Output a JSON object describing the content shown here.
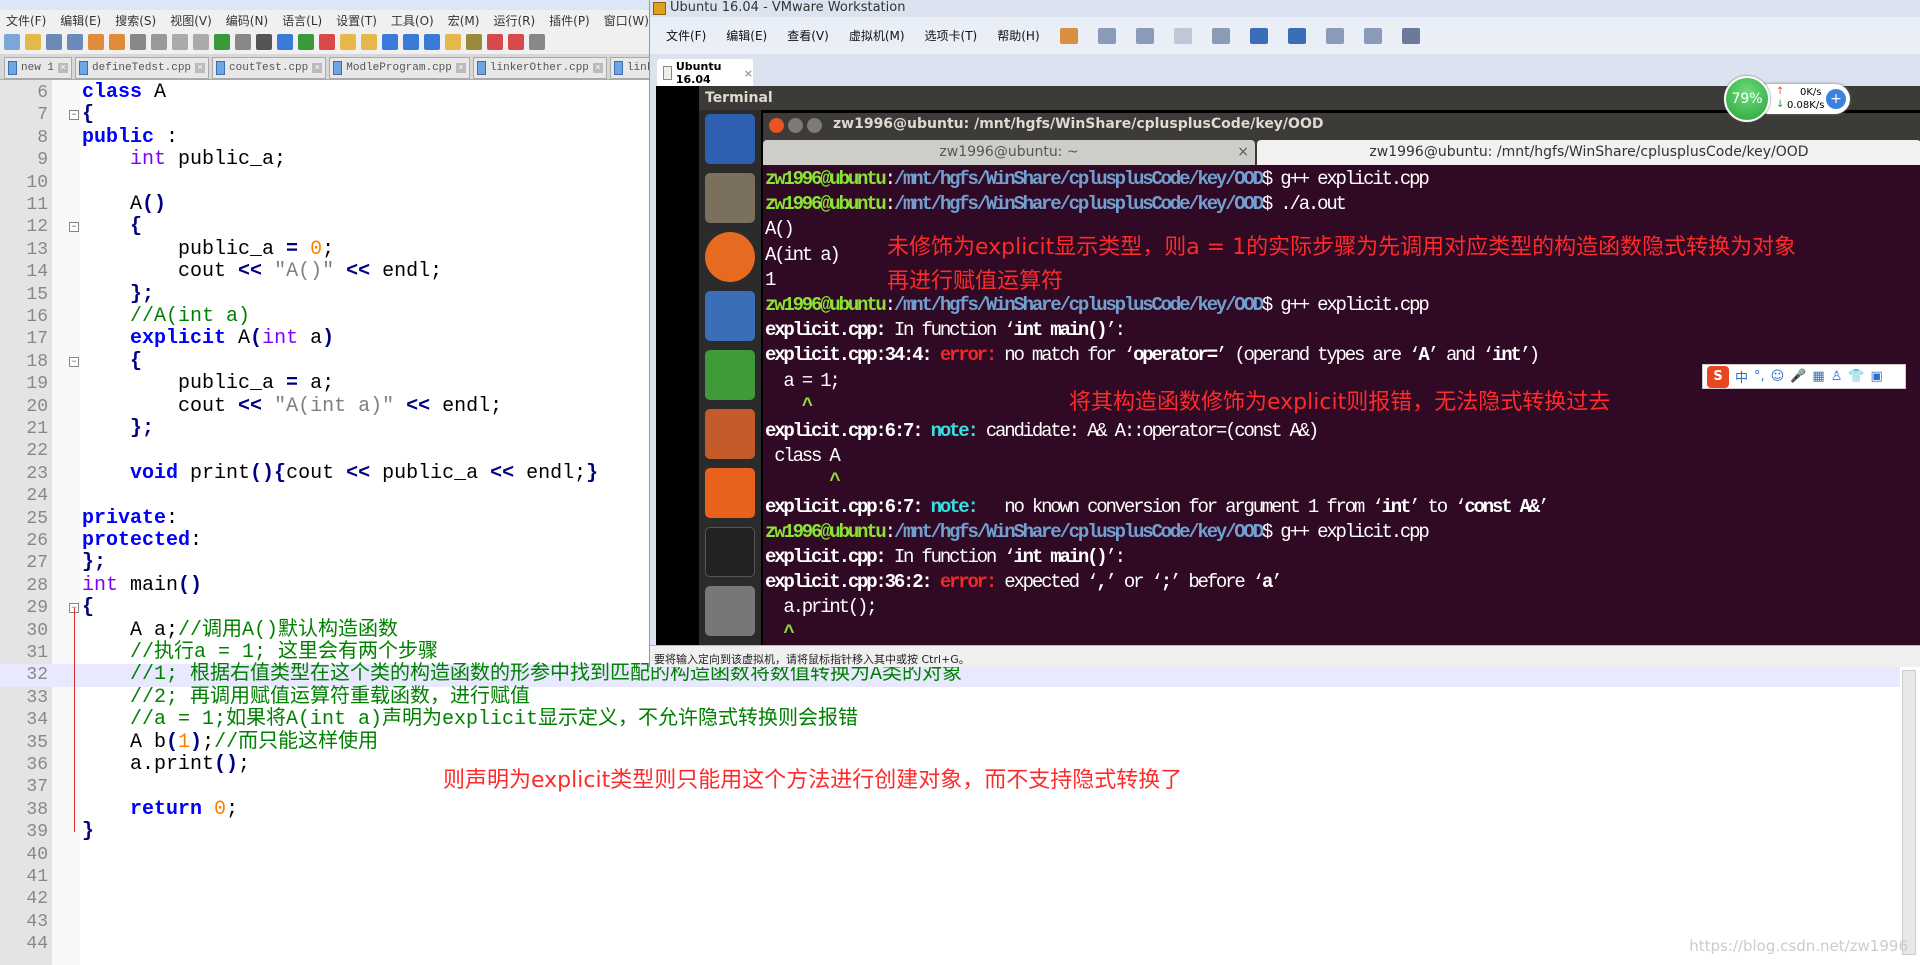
{
  "notepad": {
    "menu": [
      "文件(F)",
      "编辑(E)",
      "搜索(S)",
      "视图(V)",
      "编码(N)",
      "语言(L)",
      "设置(T)",
      "工具(O)",
      "宏(M)",
      "运行(R)",
      "插件(P)",
      "窗口(W)"
    ],
    "tabs": [
      "new 1",
      "defineTedst.cpp",
      "coutTest.cpp",
      "ModleProgram.cpp",
      "linkerOther.cpp",
      "linker."
    ],
    "highlight_line": 32,
    "code": [
      {
        "n": 6,
        "t": [
          [
            "class",
            "kw"
          ],
          [
            " A",
            "pl"
          ]
        ]
      },
      {
        "n": 7,
        "t": [
          [
            "{",
            "op"
          ]
        ],
        "fold": "-"
      },
      {
        "n": 8,
        "t": [
          [
            "public",
            "kw"
          ],
          [
            " :",
            "pl"
          ]
        ]
      },
      {
        "n": 9,
        "t": [
          [
            "    ",
            "pl"
          ],
          [
            "int",
            "type"
          ],
          [
            " public_a;",
            "pl"
          ]
        ]
      },
      {
        "n": 10,
        "t": []
      },
      {
        "n": 11,
        "t": [
          [
            "    A",
            "pl"
          ],
          [
            "()",
            "op"
          ]
        ]
      },
      {
        "n": 12,
        "t": [
          [
            "    ",
            "pl"
          ],
          [
            "{",
            "op"
          ]
        ],
        "fold": "-"
      },
      {
        "n": 13,
        "t": [
          [
            "        public_a ",
            "pl"
          ],
          [
            "=",
            "op"
          ],
          [
            " ",
            "pl"
          ],
          [
            "0",
            "num"
          ],
          [
            ";",
            "pl"
          ]
        ]
      },
      {
        "n": 14,
        "t": [
          [
            "        cout ",
            "pl"
          ],
          [
            "<<",
            "op"
          ],
          [
            " ",
            "pl"
          ],
          [
            "\"A()\"",
            "str"
          ],
          [
            " ",
            "pl"
          ],
          [
            "<<",
            "op"
          ],
          [
            " endl;",
            "pl"
          ]
        ]
      },
      {
        "n": 15,
        "t": [
          [
            "    ",
            "pl"
          ],
          [
            "};",
            "op"
          ]
        ]
      },
      {
        "n": 16,
        "t": [
          [
            "    ",
            "pl"
          ],
          [
            "//A(int a)",
            "cm"
          ]
        ]
      },
      {
        "n": 17,
        "t": [
          [
            "    ",
            "pl"
          ],
          [
            "explicit",
            "kw"
          ],
          [
            " A",
            "pl"
          ],
          [
            "(",
            "op"
          ],
          [
            "int",
            "type"
          ],
          [
            " a",
            "pl"
          ],
          [
            ")",
            "op"
          ]
        ]
      },
      {
        "n": 18,
        "t": [
          [
            "    ",
            "pl"
          ],
          [
            "{",
            "op"
          ]
        ],
        "fold": "-"
      },
      {
        "n": 19,
        "t": [
          [
            "        public_a ",
            "pl"
          ],
          [
            "=",
            "op"
          ],
          [
            " a;",
            "pl"
          ]
        ]
      },
      {
        "n": 20,
        "t": [
          [
            "        cout ",
            "pl"
          ],
          [
            "<<",
            "op"
          ],
          [
            " ",
            "pl"
          ],
          [
            "\"A(int a)\"",
            "str"
          ],
          [
            " ",
            "pl"
          ],
          [
            "<<",
            "op"
          ],
          [
            " endl;",
            "pl"
          ]
        ]
      },
      {
        "n": 21,
        "t": [
          [
            "    ",
            "pl"
          ],
          [
            "};",
            "op"
          ]
        ]
      },
      {
        "n": 22,
        "t": []
      },
      {
        "n": 23,
        "t": [
          [
            "    ",
            "pl"
          ],
          [
            "void",
            "kw"
          ],
          [
            " print",
            "pl"
          ],
          [
            "(){",
            "op"
          ],
          [
            "cout ",
            "pl"
          ],
          [
            "<<",
            "op"
          ],
          [
            " public_a ",
            "pl"
          ],
          [
            "<<",
            "op"
          ],
          [
            " endl;",
            "pl"
          ],
          [
            "}",
            "op"
          ]
        ]
      },
      {
        "n": 24,
        "t": []
      },
      {
        "n": 25,
        "t": [
          [
            "private",
            "kw"
          ],
          [
            ":",
            "pl"
          ]
        ]
      },
      {
        "n": 26,
        "t": [
          [
            "protected",
            "kw"
          ],
          [
            ":",
            "pl"
          ]
        ]
      },
      {
        "n": 27,
        "t": [
          [
            "};",
            "op"
          ]
        ]
      },
      {
        "n": 28,
        "t": [
          [
            "int",
            "type"
          ],
          [
            " main",
            "pl"
          ],
          [
            "()",
            "op"
          ]
        ]
      },
      {
        "n": 29,
        "t": [
          [
            "{",
            "op"
          ]
        ],
        "fold": "-"
      },
      {
        "n": 30,
        "t": [
          [
            "    A a;",
            "pl"
          ],
          [
            "//调用A()默认构造函数",
            "cm"
          ]
        ]
      },
      {
        "n": 31,
        "t": [
          [
            "    ",
            "pl"
          ],
          [
            "//执行a = 1; 这里会有两个步骤",
            "cm"
          ]
        ]
      },
      {
        "n": 32,
        "t": [
          [
            "    ",
            "pl"
          ],
          [
            "//1; 根据右值类型在这个类的构造函数的形参中找到匹配的构造函数将数值转换为A类的对象",
            "cm"
          ]
        ]
      },
      {
        "n": 33,
        "t": [
          [
            "    ",
            "pl"
          ],
          [
            "//2; 再调用赋值运算符重载函数，进行赋值",
            "cm"
          ]
        ]
      },
      {
        "n": 34,
        "t": [
          [
            "    ",
            "pl"
          ],
          [
            "//a = 1;如果将A(int a)声明为explicit显示定义，不允许隐式转换则会报错",
            "cm"
          ]
        ]
      },
      {
        "n": 35,
        "t": [
          [
            "    A b",
            "pl"
          ],
          [
            "(",
            "op"
          ],
          [
            "1",
            "num"
          ],
          [
            ")",
            "op"
          ],
          [
            ";",
            "pl"
          ],
          [
            "//而只能这样使用",
            "cm"
          ]
        ]
      },
      {
        "n": 36,
        "t": [
          [
            "    a.print",
            "pl"
          ],
          [
            "()",
            "op"
          ],
          [
            ";",
            "pl"
          ]
        ]
      },
      {
        "n": 37,
        "t": []
      },
      {
        "n": 38,
        "t": [
          [
            "    ",
            "pl"
          ],
          [
            "return",
            "kw"
          ],
          [
            " ",
            "pl"
          ],
          [
            "0",
            "num"
          ],
          [
            ";",
            "pl"
          ]
        ]
      },
      {
        "n": 39,
        "t": [
          [
            "}",
            "op"
          ]
        ]
      },
      {
        "n": 40,
        "t": []
      },
      {
        "n": 41,
        "t": []
      },
      {
        "n": 42,
        "t": []
      },
      {
        "n": 43,
        "t": []
      },
      {
        "n": 44,
        "t": []
      }
    ],
    "annotation": "则声明为explicit类型则只能用这个方法进行创建对象，而不支持隐式转换了"
  },
  "vmware": {
    "title": "Ubuntu 16.04 - VMware Workstation",
    "menu": [
      "文件(F)",
      "编辑(E)",
      "查看(V)",
      "虚拟机(M)",
      "选项卡(T)",
      "帮助(H)"
    ],
    "tab_label": "Ubuntu 16.04",
    "status": "要将输入定向到该虚拟机，请将鼠标指针移入其中或按 Ctrl+G。"
  },
  "ubuntu": {
    "topbar_title": "Terminal",
    "window_title": "zw1996@ubuntu: /mnt/hgfs/WinShare/cplusplusCode/key/OOD",
    "tabs": [
      "zw1996@ubuntu: ~",
      "zw1996@ubuntu: /mnt/hgfs/WinShare/cplusplusCode/key/OOD"
    ],
    "lines": [
      [
        [
          "zw1996@ubuntu",
          "tu"
        ],
        [
          ":",
          "tw"
        ],
        [
          "/mnt/hgfs/WinShare/cplusplusCode/key/OOD",
          "tp"
        ],
        [
          "$ g++ explicit.cpp",
          "tw"
        ]
      ],
      [
        [
          "zw1996@ubuntu",
          "tu"
        ],
        [
          ":",
          "tw"
        ],
        [
          "/mnt/hgfs/WinShare/cplusplusCode/key/OOD",
          "tp"
        ],
        [
          "$ ./a.out",
          "tw"
        ]
      ],
      [
        [
          "A()",
          "tw"
        ]
      ],
      [
        [
          "A(int a)",
          "tw"
        ]
      ],
      [
        [
          "1",
          "tw"
        ]
      ],
      [
        [
          "zw1996@ubuntu",
          "tu"
        ],
        [
          ":",
          "tw"
        ],
        [
          "/mnt/hgfs/WinShare/cplusplusCode/key/OOD",
          "tp"
        ],
        [
          "$ g++ explicit.cpp",
          "tw"
        ]
      ],
      [
        [
          "explicit.cpp:",
          "tb2"
        ],
        [
          " In function ‘",
          "tw"
        ],
        [
          "int main()",
          "tb2"
        ],
        [
          "’:",
          "tw"
        ]
      ],
      [
        [
          "explicit.cpp:34:4:",
          "tb2"
        ],
        [
          " ",
          "tw"
        ],
        [
          "error:",
          "terr"
        ],
        [
          " no match for ‘",
          "tw"
        ],
        [
          "operator=",
          "tb2"
        ],
        [
          "’ (operand types are ‘",
          "tw"
        ],
        [
          "A",
          "tb2"
        ],
        [
          "’ and ‘",
          "tw"
        ],
        [
          "int",
          "tb2"
        ],
        [
          "’)",
          "tw"
        ]
      ],
      [
        [
          "  a = 1;",
          "tw"
        ]
      ],
      [
        [
          "    ^",
          "tcar"
        ]
      ],
      [
        [
          "explicit.cpp:6:7:",
          "tb2"
        ],
        [
          " ",
          "tw"
        ],
        [
          "note:",
          "tnote"
        ],
        [
          " candidate: A& A::operator=(const A&)",
          "tw"
        ]
      ],
      [
        [
          " class A",
          "tw"
        ]
      ],
      [
        [
          "       ^",
          "tcar"
        ]
      ],
      [
        [
          "explicit.cpp:6:7:",
          "tb2"
        ],
        [
          " ",
          "tw"
        ],
        [
          "note:",
          "tnote"
        ],
        [
          "   no known conversion for argument 1 from ‘",
          "tw"
        ],
        [
          "int",
          "tb2"
        ],
        [
          "’ to ‘",
          "tw"
        ],
        [
          "const A&",
          "tb2"
        ],
        [
          "’",
          "tw"
        ]
      ],
      [
        [
          "zw1996@ubuntu",
          "tu"
        ],
        [
          ":",
          "tw"
        ],
        [
          "/mnt/hgfs/WinShare/cplusplusCode/key/OOD",
          "tp"
        ],
        [
          "$ g++ explicit.cpp",
          "tw"
        ]
      ],
      [
        [
          "explicit.cpp:",
          "tb2"
        ],
        [
          " In function ‘",
          "tw"
        ],
        [
          "int main()",
          "tb2"
        ],
        [
          "’:",
          "tw"
        ]
      ],
      [
        [
          "explicit.cpp:36:2:",
          "tb2"
        ],
        [
          " ",
          "tw"
        ],
        [
          "error:",
          "terr"
        ],
        [
          " expected ‘",
          "tw"
        ],
        [
          ",",
          "tb2"
        ],
        [
          "’ or ‘",
          "tw"
        ],
        [
          ";",
          "tb2"
        ],
        [
          "’ before ‘",
          "tw"
        ],
        [
          "a",
          "tb2"
        ],
        [
          "’",
          "tw"
        ]
      ],
      [
        [
          "  a.print();",
          "tw"
        ]
      ],
      [
        [
          "  ^",
          "tcar"
        ]
      ]
    ],
    "annotation1_line1": "未修饰为explicit显示类型，则a = 1的实际步骤为先调用对应类型的构造函数隐式转换为对象",
    "annotation1_line2": "再进行赋值运算符",
    "annotation2": "将其构造函数修饰为explicit则报错，无法隐式转换过去"
  },
  "net_widget": {
    "percent": "79%",
    "up": "0K/s",
    "down": "0.08K/s"
  },
  "ime": {
    "label": "中"
  },
  "watermark": "https://blog.csdn.net/zw1996"
}
